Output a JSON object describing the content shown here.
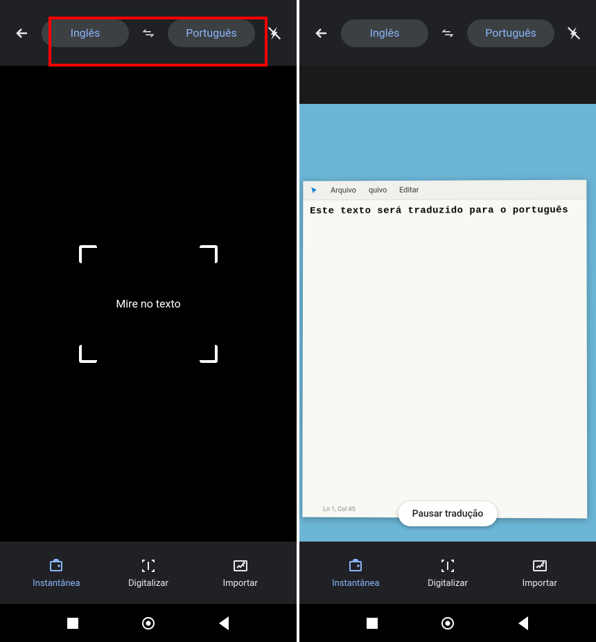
{
  "left": {
    "topbar": {
      "source_lang": "Inglês",
      "target_lang": "Português"
    },
    "aim_hint": "Mire no texto",
    "modes": {
      "instant": "Instantânea",
      "scan": "Digitalizar",
      "import": "Importar"
    }
  },
  "right": {
    "topbar": {
      "source_lang": "Inglês",
      "target_lang": "Português"
    },
    "notepad": {
      "menu": {
        "arquivo": "Arquivo",
        "quivo": "quivo",
        "editar": "Editar"
      },
      "translated_text": "Este texto será traduzido para o português",
      "status": "Ln 1, Col 45"
    },
    "pause_label": "Pausar tradução",
    "modes": {
      "instant": "Instantânea",
      "scan": "Digitalizar",
      "import": "Importar"
    }
  }
}
